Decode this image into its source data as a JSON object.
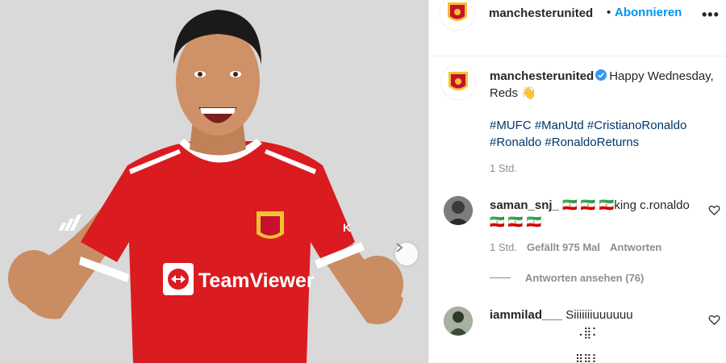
{
  "media": {
    "jersey_sponsor": "TeamViewer",
    "jersey_brand": "adidas",
    "carousel_next_icon": "chevron-right-icon",
    "colors": {
      "background": "#d6d6d6",
      "jersey": "#da1b20",
      "trim": "#ffffff"
    }
  },
  "header": {
    "username": "manchesterunited",
    "separator": "•",
    "follow_label": "Abonnieren",
    "more_label": "•••"
  },
  "caption": {
    "username": "manchesterunited",
    "text": "Happy Wednesday, Reds 👋",
    "hashtags": [
      "#MUFC",
      "#ManUtd",
      "#CristianoRonaldo",
      "#Ronaldo",
      "#RonaldoReturns"
    ],
    "time": "1 Std."
  },
  "comments": [
    {
      "username": "saman_snj_",
      "text": "🇮🇷 🇮🇷 🇮🇷king c.ronaldo🇮🇷 🇮🇷 🇮🇷",
      "time": "1 Std.",
      "likes": "Gefällt 975 Mal",
      "reply_label": "Antworten",
      "view_replies": "Antworten ansehen (76)"
    },
    {
      "username": "iammilad___",
      "text": "Siiiiiiiuuuuuu",
      "extra_line_1": "⠠⣿⠅",
      "extra_line_2": "⠿⠿⠇"
    }
  ],
  "colors": {
    "link_blue": "#0095f6",
    "hashtag": "#00376b",
    "muted": "#8e8e8e",
    "verified": "#3897f0"
  }
}
